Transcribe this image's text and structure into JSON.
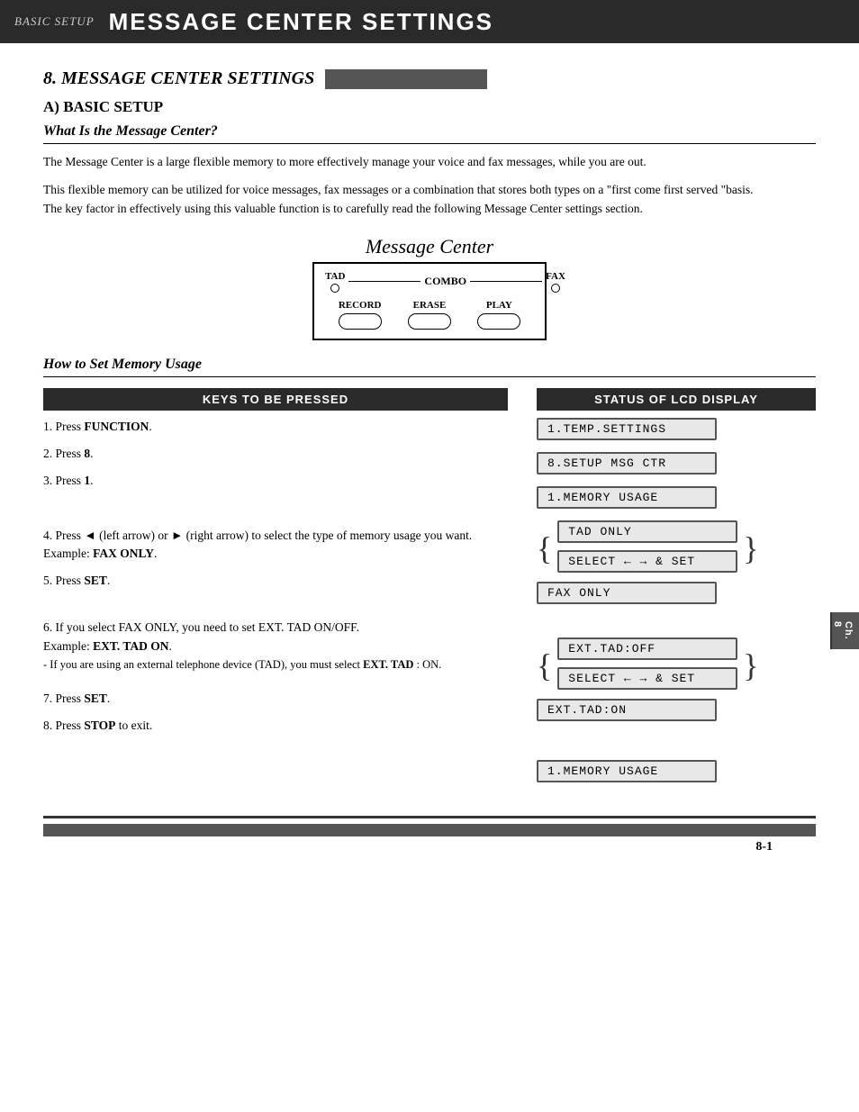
{
  "header": {
    "basic_setup_label": "BASIC SETUP",
    "title": "MESSAGE CENTER SETTINGS"
  },
  "section": {
    "main_heading": "8. MESSAGE CENTER SETTINGS",
    "sub_heading": "A) BASIC SETUP",
    "what_is_heading": "What Is the Message Center?",
    "body1": "The Message Center is a large flexible memory to more effectively manage your voice and fax messages, while you are out.",
    "body2": "This flexible memory can be utilized for voice messages, fax messages or a combination that stores both types on a \"first come first served \"basis.\nThe key factor in effectively using this valuable function is to carefully read the following Message Center settings section.",
    "diagram_title": "Message Center",
    "diagram": {
      "tad_label": "TAD",
      "combo_label": "COMBO",
      "fax_label": "FAX",
      "record_label": "RECORD",
      "erase_label": "ERASE",
      "play_label": "PLAY"
    },
    "how_to_heading": "How to Set Memory Usage",
    "keys_header": "KEYS TO BE PRESSED",
    "status_header": "STATUS OF LCD DISPLAY",
    "steps": [
      {
        "num": "1.",
        "text": "Press ",
        "bold": "FUNCTION",
        "rest": "."
      },
      {
        "num": "2.",
        "text": "Press ",
        "bold": "8",
        "rest": "."
      },
      {
        "num": "3.",
        "text": "Press ",
        "bold": "1",
        "rest": "."
      },
      {
        "num": "4.",
        "text": "Press ◄ (left arrow) or ► (right arrow) to select the type of memory usage you want.\nExample: ",
        "bold": "FAX ONLY",
        "rest": "."
      },
      {
        "num": "5.",
        "text": "Press ",
        "bold": "SET",
        "rest": "."
      },
      {
        "num": "6.",
        "text": "If you select FAX ONLY, you need to set EXT. TAD ON/OFF.\nExample: ",
        "bold": "EXT. TAD ON",
        "rest": ".\n- If you are using an external telephone device (TAD), you must select ",
        "bold2": "EXT. TAD",
        "rest2": " : ON."
      },
      {
        "num": "7.",
        "text": "Press ",
        "bold": "SET",
        "rest": "."
      },
      {
        "num": "8.",
        "text": "Press ",
        "bold": "STOP",
        "rest": " to exit."
      }
    ],
    "lcd_displays": {
      "step1": "1.TEMP.SETTINGS",
      "step2": "8.SETUP MSG CTR",
      "step3": "1.MEMORY USAGE",
      "step4_top": "TAD  ONLY",
      "step4_select": "SELECT ← → & SET",
      "step4_bot": "FAX  ONLY",
      "step5_top": "EXT.TAD:OFF",
      "step5_select": "SELECT ← → & SET",
      "step5_bot": "EXT.TAD:ON",
      "step7": "1.MEMORY USAGE"
    },
    "chapter_tab": "Ch.\n8",
    "page_number": "8-1"
  }
}
